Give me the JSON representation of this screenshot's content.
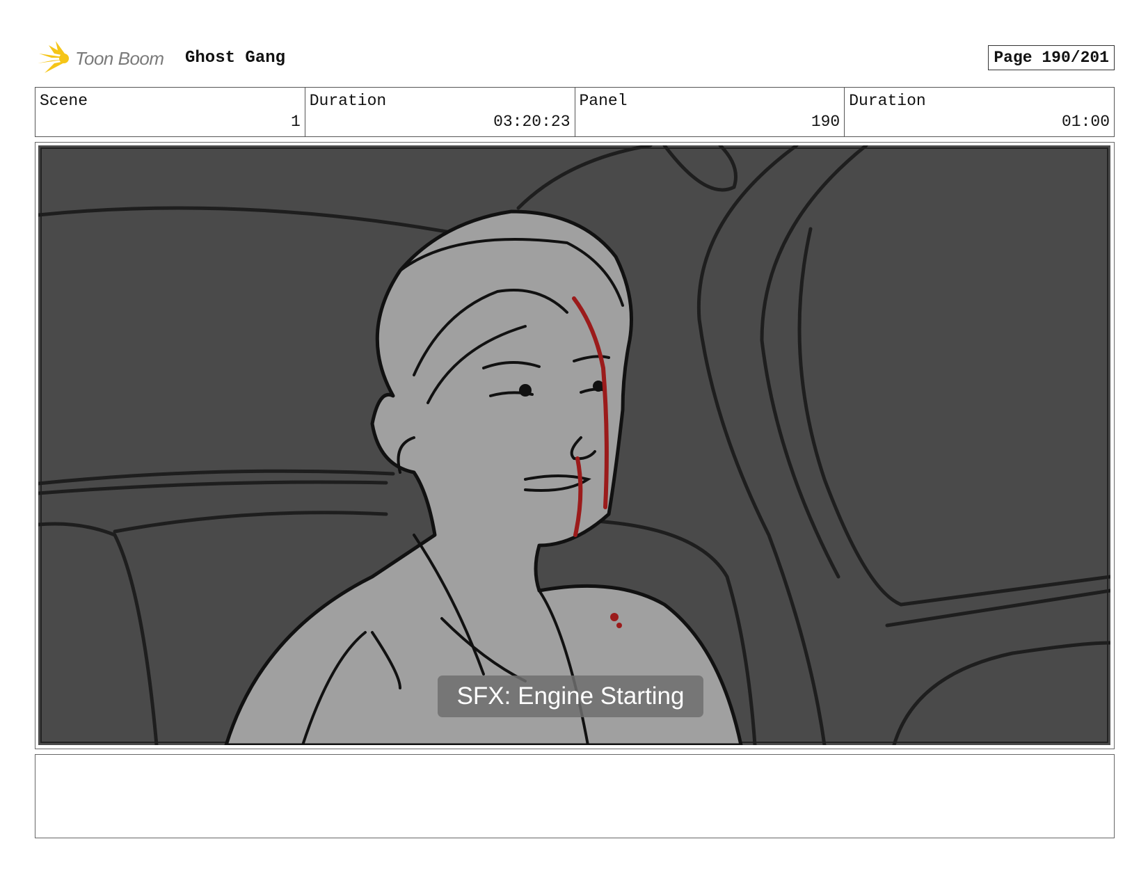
{
  "header": {
    "logo_text": "Toon Boom",
    "project_title": "Ghost Gang",
    "page_label": "Page 190/201",
    "logo_color": "#f5c518"
  },
  "info": {
    "scene_label": "Scene",
    "scene_value": "1",
    "scene_duration_label": "Duration",
    "scene_duration_value": "03:20:23",
    "panel_label": "Panel",
    "panel_value": "190",
    "panel_duration_label": "Duration",
    "panel_duration_value": "01:00"
  },
  "panel": {
    "caption": "SFX: Engine Starting",
    "background_color": "#4a4a4a",
    "figure_color": "#a0a0a0",
    "blood_color": "#9b1b1b"
  },
  "notes": {
    "text": ""
  }
}
